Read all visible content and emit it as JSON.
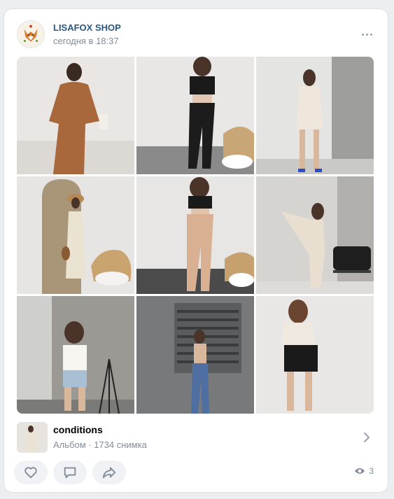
{
  "post": {
    "author": "LISAFOX SHOP",
    "time": "сегодня в 18:37"
  },
  "photos": [
    {
      "icon": "photo-1"
    },
    {
      "icon": "photo-2"
    },
    {
      "icon": "photo-3"
    },
    {
      "icon": "photo-4"
    },
    {
      "icon": "photo-5"
    },
    {
      "icon": "photo-6"
    },
    {
      "icon": "photo-7"
    },
    {
      "icon": "photo-8"
    },
    {
      "icon": "photo-9"
    }
  ],
  "album": {
    "title": "conditions",
    "subtitle": "Альбом · 1734 снимка"
  },
  "actions": {
    "views": "3"
  },
  "colors": {
    "link": "#2a5885",
    "secondary": "#818c99",
    "button_bg": "#f0f2f5",
    "icon": "#818c99"
  }
}
